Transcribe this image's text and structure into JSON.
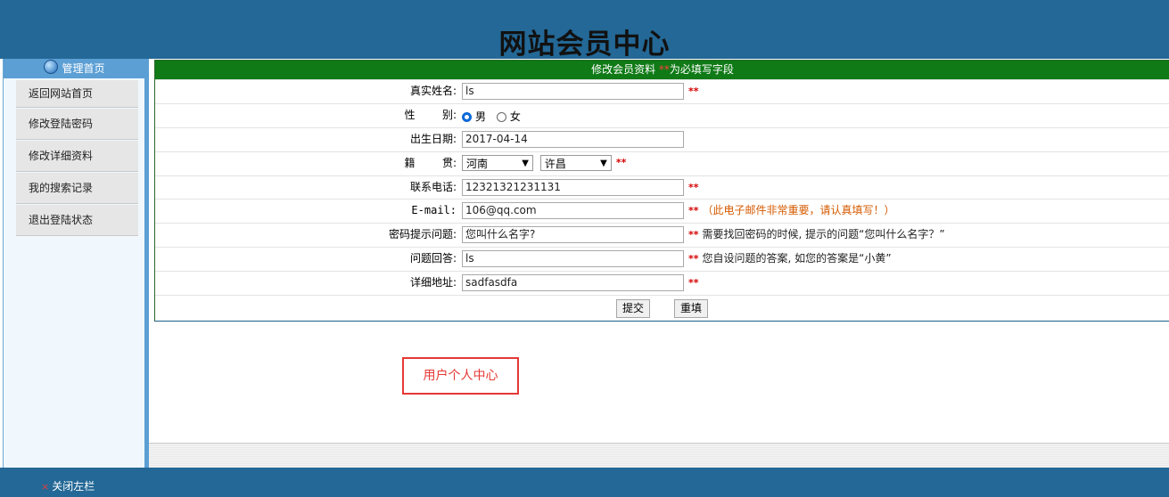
{
  "header": {
    "title": "网站会员中心"
  },
  "sidebar": {
    "head_label": "管理首页",
    "items": [
      {
        "label": "返回网站首页"
      },
      {
        "label": "修改登陆密码"
      },
      {
        "label": "修改详细资料"
      },
      {
        "label": "我的搜索记录"
      },
      {
        "label": "退出登陆状态"
      }
    ]
  },
  "form": {
    "head_text": "修改会员资料",
    "head_req": "**",
    "head_suffix": "为必填写字段",
    "required_mark": "**",
    "name": {
      "label": "真实姓名:",
      "value": "ls"
    },
    "gender": {
      "label": "性        别:",
      "male": "男",
      "female": "女",
      "selected": "男"
    },
    "birthday": {
      "label": "出生日期:",
      "value": "2017-04-14"
    },
    "origin": {
      "label": "籍        贯:",
      "province": "河南",
      "city": "许昌"
    },
    "phone": {
      "label": "联系电话:",
      "value": "12321321231131"
    },
    "email": {
      "label": "E-mail:",
      "value": "106@qq.com",
      "hint": "（此电子邮件非常重要，请认真填写！）"
    },
    "question": {
      "label": "密码提示问题:",
      "value": "您叫什么名字?",
      "hint": "需要找回密码的时候, 提示的问题“您叫什么名字？”"
    },
    "answer": {
      "label": "问题回答:",
      "value": "ls",
      "hint": "您自设问题的答案, 如您的答案是“小黄”"
    },
    "address": {
      "label": "详细地址:",
      "value": "sadfasdfa"
    },
    "submit_label": "提交",
    "reset_label": "重填"
  },
  "callout": {
    "text": "用户个人中心"
  },
  "footer": {
    "close_label": "关闭左栏",
    "close_icon": "×"
  },
  "colors": {
    "header": "#236896",
    "form_head": "#0f7a16",
    "required": "#d40000",
    "callout": "#e53935"
  }
}
